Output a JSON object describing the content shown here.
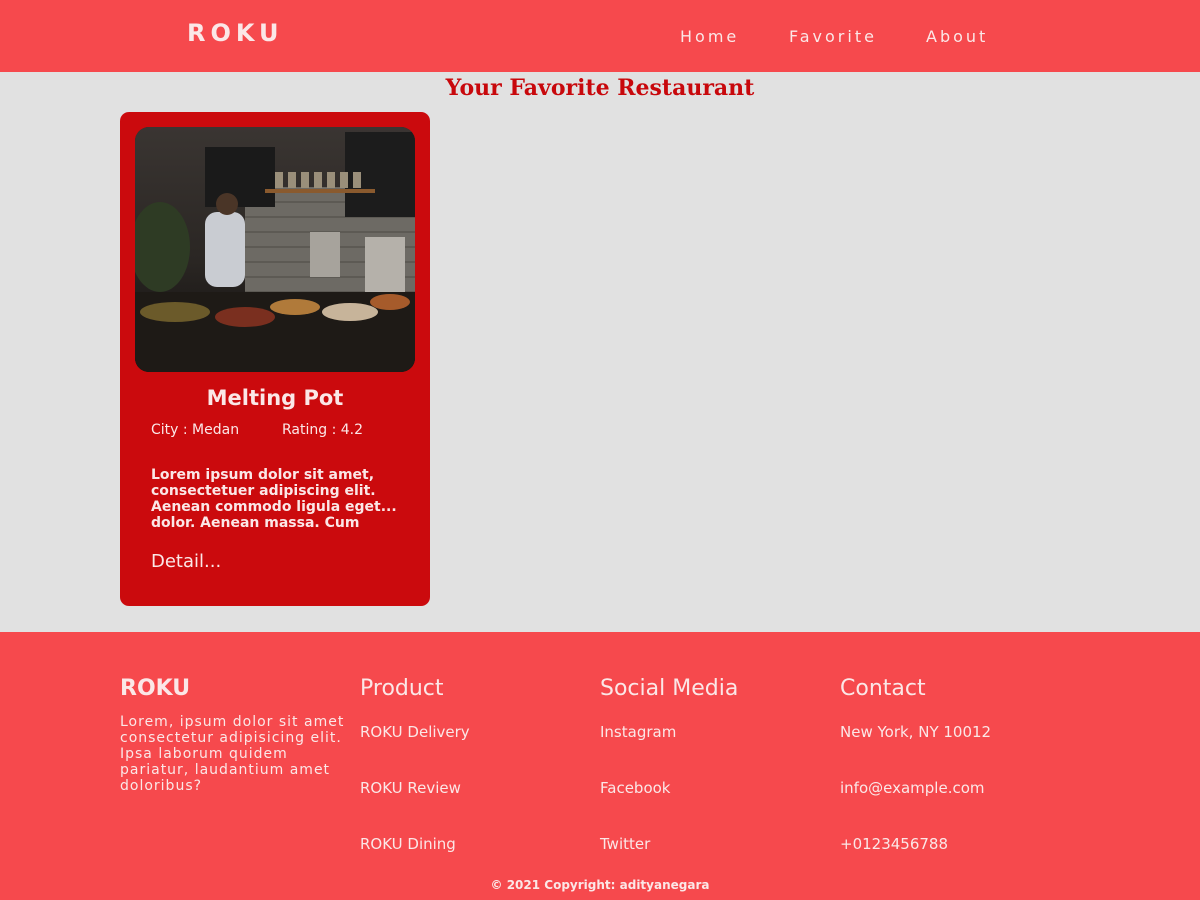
{
  "header": {
    "brand": "ROKU",
    "nav": [
      "Home",
      "Favorite",
      "About"
    ]
  },
  "main": {
    "section_title": "Your Favorite Restaurant",
    "restaurants": [
      {
        "name": "Melting Pot",
        "city_label": "City : Medan",
        "rating_label": "Rating : 4.2",
        "description": "Lorem ipsum dolor sit amet, consectetuer adipiscing elit. Aenean commodo ligula eget... dolor. Aenean massa. Cum sociis",
        "detail_link": "Detail..."
      }
    ]
  },
  "footer": {
    "brand": "ROKU",
    "about": "Lorem, ipsum dolor sit amet consectetur adipisicing elit. Ipsa laborum quidem pariatur, laudantium amet doloribus?",
    "product": {
      "title": "Product",
      "items": [
        "ROKU Delivery",
        "ROKU Review",
        "ROKU Dining"
      ]
    },
    "social": {
      "title": "Social Media",
      "items": [
        "Instagram",
        "Facebook",
        "Twitter"
      ]
    },
    "contact": {
      "title": "Contact",
      "items": [
        "New York, NY 10012",
        "info@example.com",
        "+0123456788"
      ]
    },
    "copyright": "© 2021 Copyright: adityanegara"
  },
  "colors": {
    "header_bg": "#f6494d",
    "card_bg": "#cb0a0d",
    "page_bg": "#e1e1e1",
    "accent_text": "#c8080c"
  }
}
